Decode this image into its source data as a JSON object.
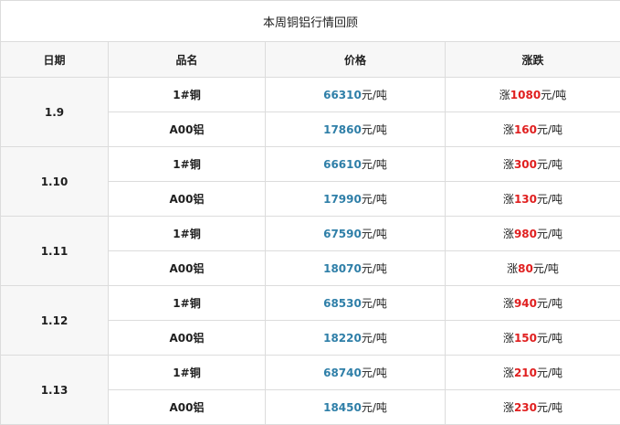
{
  "table": {
    "title": "本周铜铝行情回顾",
    "headers": [
      "日期",
      "品名",
      "价格",
      "涨跌"
    ],
    "days": [
      {
        "date": "1.9",
        "items": [
          {
            "product": "1#铜",
            "price": "66310",
            "price_unit": "元/吨",
            "change_prefix": "涨",
            "change": "1080",
            "change_unit": "元/吨"
          },
          {
            "product": "A00铝",
            "price": "17860",
            "price_unit": "元/吨",
            "change_prefix": "涨",
            "change": "160",
            "change_unit": "元/吨"
          }
        ]
      },
      {
        "date": "1.10",
        "items": [
          {
            "product": "1#铜",
            "price": "66610",
            "price_unit": "元/吨",
            "change_prefix": "涨",
            "change": "300",
            "change_unit": "元/吨"
          },
          {
            "product": "A00铝",
            "price": "17990",
            "price_unit": "元/吨",
            "change_prefix": "涨",
            "change": "130",
            "change_unit": "元/吨"
          }
        ]
      },
      {
        "date": "1.11",
        "items": [
          {
            "product": "1#铜",
            "price": "67590",
            "price_unit": "元/吨",
            "change_prefix": "涨",
            "change": "980",
            "change_unit": "元/吨"
          },
          {
            "product": "A00铝",
            "price": "18070",
            "price_unit": "元/吨",
            "change_prefix": "涨",
            "change": "80",
            "change_unit": "元/吨"
          }
        ]
      },
      {
        "date": "1.12",
        "items": [
          {
            "product": "1#铜",
            "price": "68530",
            "price_unit": "元/吨",
            "change_prefix": "涨",
            "change": "940",
            "change_unit": "元/吨"
          },
          {
            "product": "A00铝",
            "price": "18220",
            "price_unit": "元/吨",
            "change_prefix": "涨",
            "change": "150",
            "change_unit": "元/吨"
          }
        ]
      },
      {
        "date": "1.13",
        "items": [
          {
            "product": "1#铜",
            "price": "68740",
            "price_unit": "元/吨",
            "change_prefix": "涨",
            "change": "210",
            "change_unit": "元/吨"
          },
          {
            "product": "A00铝",
            "price": "18450",
            "price_unit": "元/吨",
            "change_prefix": "涨",
            "change": "230",
            "change_unit": "元/吨"
          }
        ]
      }
    ]
  },
  "colors": {
    "price": "#2f7fa8",
    "change": "#e02020",
    "border": "#dcdcdc",
    "header_bg": "#f7f7f7"
  }
}
